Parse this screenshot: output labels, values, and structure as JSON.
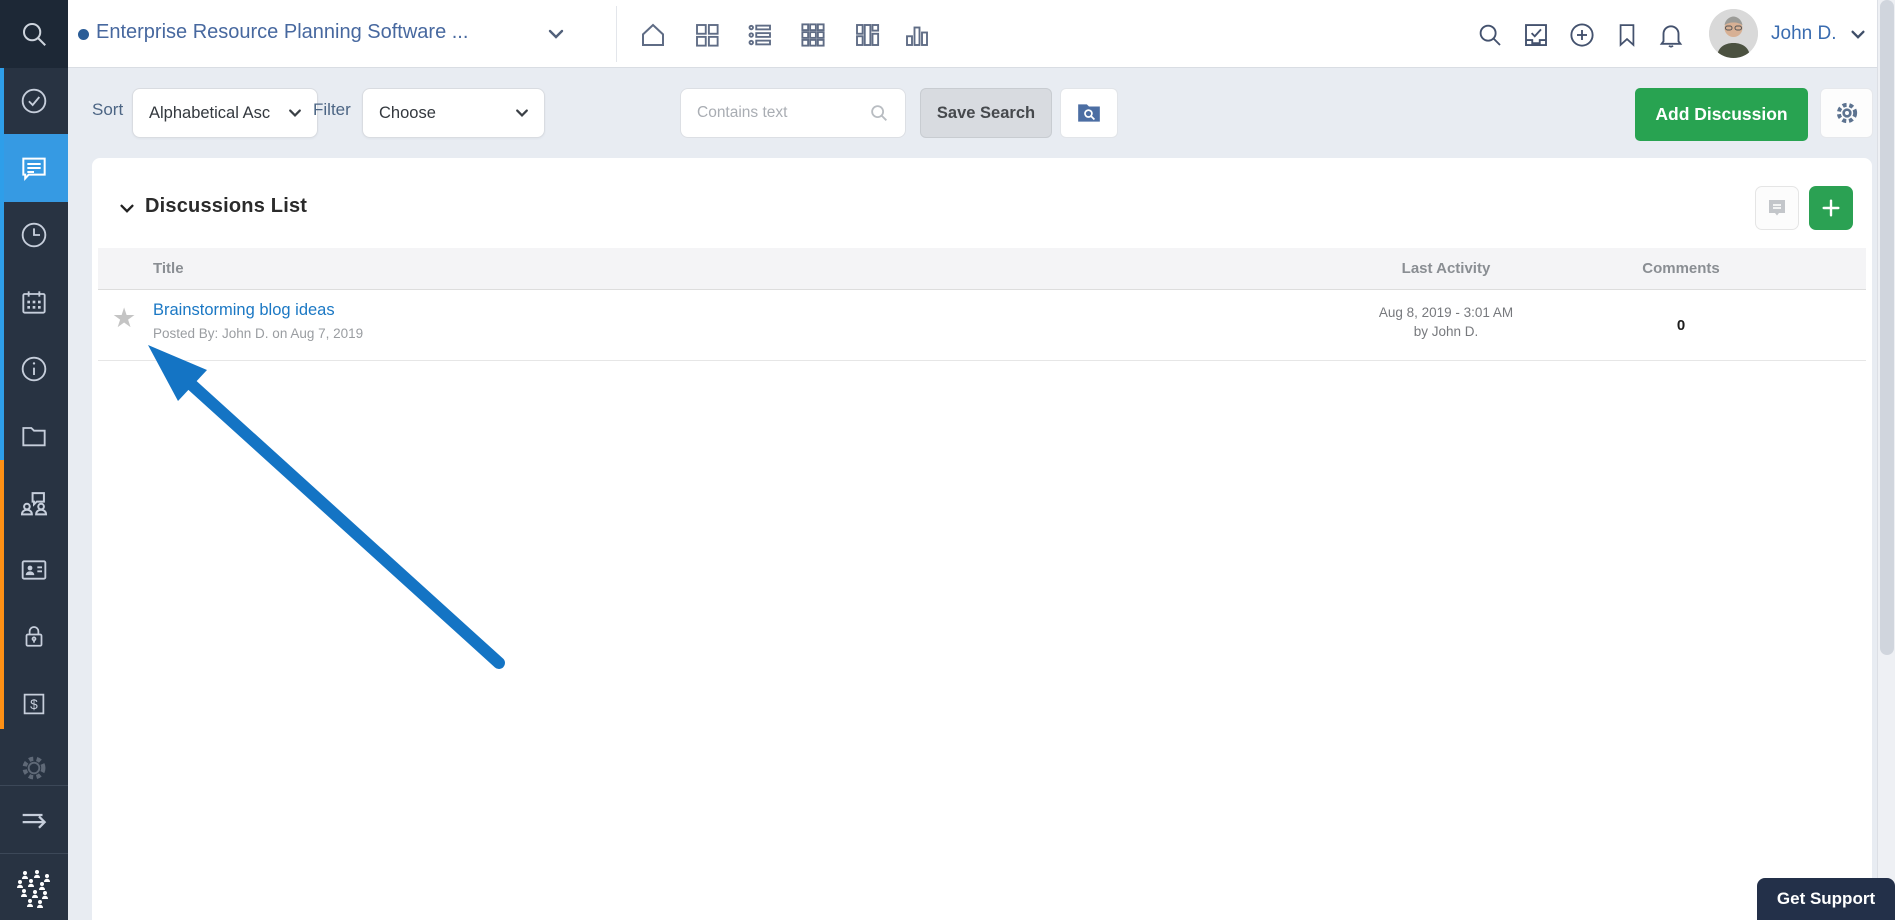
{
  "header": {
    "project_title": "Enterprise Resource Planning Software ...",
    "user_name": "John D.",
    "view_icons": [
      "home-icon",
      "grid-2x2-icon",
      "list-view-icon",
      "grid-3x3-icon",
      "board-columns-icon",
      "bar-chart-icon"
    ],
    "right_icons": [
      "search-icon",
      "tasks-checkbox-icon",
      "add-circle-icon",
      "bookmark-icon",
      "notifications-bell-icon"
    ]
  },
  "sidebar": {
    "icons": [
      "search-icon",
      "check-circle-icon",
      "discussions-chat-icon",
      "history-clock-icon",
      "calendar-icon",
      "info-icon",
      "documents-folder-icon",
      "workload-people-icon",
      "contacts-card-icon",
      "permissions-lock-icon",
      "expenses-dollar-icon",
      "settings-gear-icon",
      "collapse-arrow-icon",
      "workzone-logo"
    ],
    "active_item": "discussions-chat-icon",
    "accent_colors": {
      "blue": "#2e9ee9",
      "orange": "#ff9115"
    }
  },
  "toolbar": {
    "sort_label": "Sort",
    "sort_value": "Alphabetical Asc",
    "filter_label": "Filter",
    "filter_value": "Choose",
    "search_placeholder": "Contains text",
    "save_search_label": "Save Search",
    "add_button_label": "Add Discussion"
  },
  "main": {
    "section_title": "Discussions List",
    "table": {
      "columns": [
        "Title",
        "Last Activity",
        "Comments"
      ],
      "rows": [
        {
          "title": "Brainstorming blog ideas",
          "posted_by": "Posted By: John D. on Aug 7, 2019",
          "last_activity_line1": "Aug 8, 2019 - 3:01 AM",
          "last_activity_line2": "by John D.",
          "comments": "0"
        }
      ]
    }
  },
  "support": {
    "label": "Get Support"
  },
  "colors": {
    "accent_green": "#28a351",
    "active_blue": "#369ae3",
    "arrow_blue": "#1474c4",
    "sidebar_bg": "#283342",
    "toolbar_bg": "#e8ecf2",
    "link_blue": "#1b78c4",
    "title_blue": "#47689f"
  }
}
